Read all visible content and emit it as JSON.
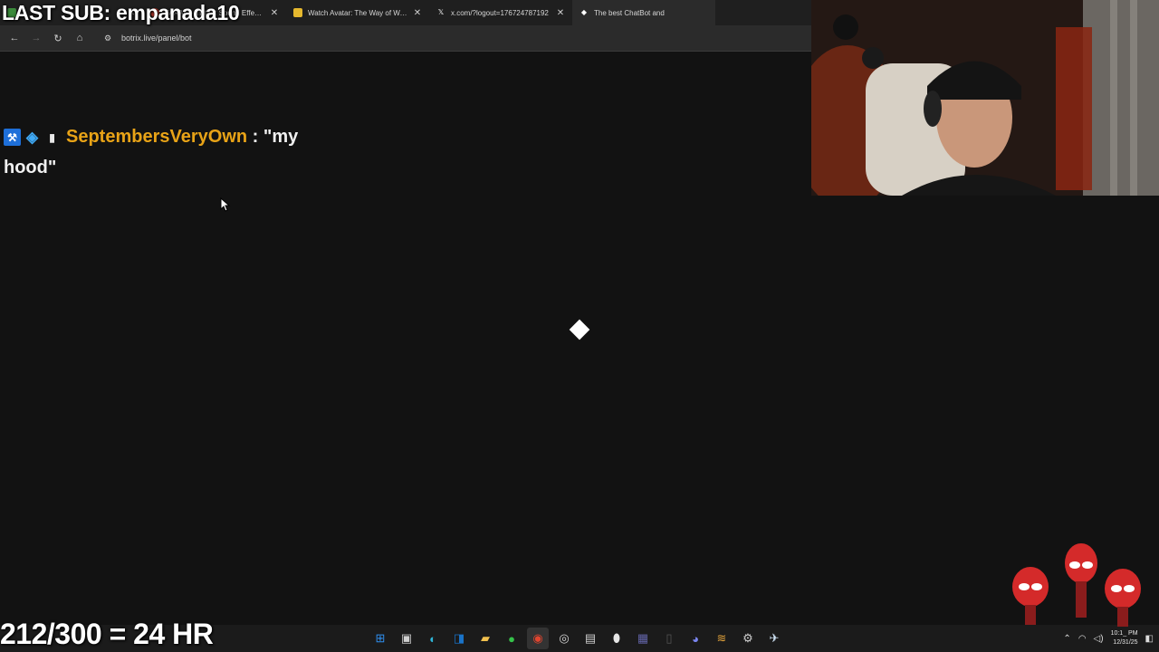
{
  "overlay": {
    "last_sub": "LAST SUB: empanada10",
    "goal": "212/300 = 24 HR"
  },
  "browser": {
    "tabs": [
      {
        "title": "",
        "favicon": "obscured-icon",
        "active": false
      },
      {
        "title": "FAAAH - Instant Sound Effect B",
        "favicon": "red-circle-icon",
        "active": false
      },
      {
        "title": "Watch Avatar: The Way of Wate",
        "favicon": "yellow-square-icon",
        "active": false
      },
      {
        "title": "x.com/?logout=176724787192",
        "favicon": "x-logo-icon",
        "active": false
      },
      {
        "title": "The best ChatBot and",
        "favicon": "botrix-icon",
        "active": true
      }
    ],
    "url": "botrix.live/panel/bot"
  },
  "chat": {
    "username": "SeptembersVeryOwn",
    "separator": " : ",
    "message": "\"my hood\"",
    "badges": [
      "hammer-badge-icon",
      "cube-badge-icon",
      "gift-badge-icon"
    ]
  },
  "taskbar": {
    "icons": [
      "windows-start-icon",
      "task-view-icon",
      "edge-icon",
      "outlook-icon",
      "file-explorer-icon",
      "xbox-icon",
      "chrome-icon",
      "obs-icon",
      "store-icon",
      "maps-pin-icon",
      "teams-icon",
      "ghost-app-icon",
      "discord-icon",
      "layers-app-icon",
      "settings-icon",
      "steam-icon"
    ],
    "time": "10:1_ PM",
    "date": "12/31/25"
  },
  "colors": {
    "username": "#e8a317",
    "background": "#121212"
  }
}
